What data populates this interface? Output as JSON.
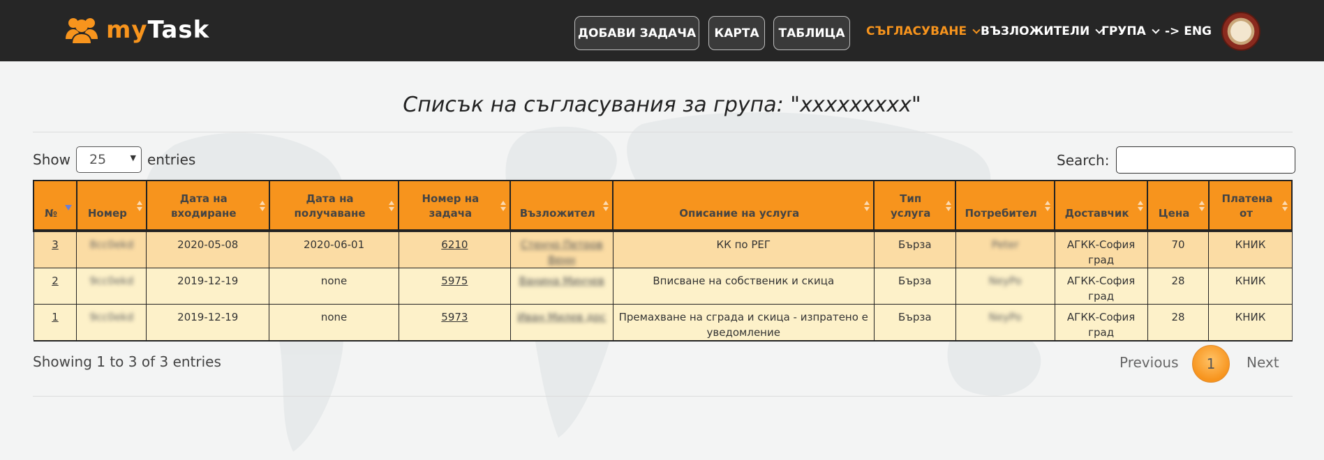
{
  "header": {
    "brand": {
      "my": "my",
      "task": "Task"
    },
    "buttons": {
      "add_task": "ДОБАВИ ЗАДАЧА",
      "map": "КАРТА",
      "table": "ТАБЛИЦА"
    },
    "menu": {
      "agreements": "СЪГЛАСУВАНЕ",
      "clients": "ВЪЗЛОЖИТЕЛИ",
      "group": "ГРУПА",
      "language": "-> ENG"
    },
    "accent_color": "#f7941d"
  },
  "page_title": "Списък на съгласувания за група: \"xxxxxxxxx\"",
  "length_control": {
    "show": "Show",
    "selected": "25",
    "entries": "entries"
  },
  "search": {
    "label": "Search:",
    "value": ""
  },
  "table": {
    "columns": [
      "№",
      "Номер",
      "Дата на входиране",
      "Дата на получаване",
      "Номер на задача",
      "Възложител",
      "Описание на услуга",
      "Тип услуга",
      "Потребител",
      "Доставчик",
      "Цена",
      "Платена от"
    ],
    "rows": [
      {
        "no": "3",
        "number": "8cc0ekd",
        "date_in": "2020-05-08",
        "date_received": "2020-06-01",
        "task_no": "6210",
        "client": "Стенчо Петров Венн",
        "description": "КК по РЕГ",
        "type": "Бърза",
        "user": "Peter",
        "provider": "АГКК-София град",
        "price": "70",
        "paid_by": "КНИК"
      },
      {
        "no": "2",
        "number": "9cc0ekd",
        "date_in": "2019-12-19",
        "date_received": "none",
        "task_no": "5975",
        "client": "Ванина Минчев",
        "description": "Вписване на собственик и скица",
        "type": "Бърза",
        "user": "NeyPo",
        "provider": "АГКК-София град",
        "price": "28",
        "paid_by": "КНИК"
      },
      {
        "no": "1",
        "number": "9cc0ekd",
        "date_in": "2019-12-19",
        "date_received": "none",
        "task_no": "5973",
        "client": "Иван Милев дрс",
        "description": "Премахване на сграда и скица - изпратено е уведомление",
        "type": "Бърза",
        "user": "NeyPo",
        "provider": "АГКК-София град",
        "price": "28",
        "paid_by": "КНИК"
      }
    ]
  },
  "info": "Showing 1 to 3 of 3 entries",
  "pagination": {
    "previous": "Previous",
    "current": "1",
    "next": "Next"
  }
}
